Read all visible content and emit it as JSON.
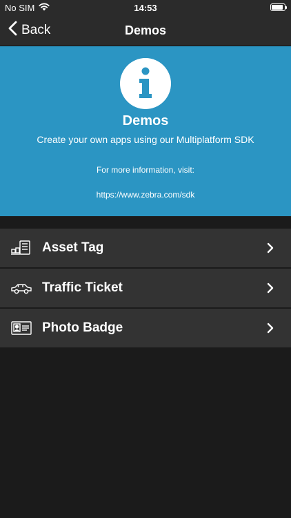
{
  "status_bar": {
    "carrier": "No SIM",
    "time": "14:53",
    "wifi_icon": "wifi-icon",
    "battery_icon": "battery-icon"
  },
  "nav": {
    "back_label": "Back",
    "title": "Demos"
  },
  "info": {
    "icon": "info-icon",
    "title": "Demos",
    "subtitle": "Create your own apps using our Multiplatform SDK",
    "more_info": "For more information, visit:",
    "url": "https://www.zebra.com/sdk"
  },
  "menu": {
    "items": [
      {
        "label": "Asset Tag",
        "icon": "asset-tag-icon"
      },
      {
        "label": "Traffic Ticket",
        "icon": "car-icon"
      },
      {
        "label": "Photo Badge",
        "icon": "badge-icon"
      }
    ]
  },
  "colors": {
    "status_bar": "#2b2b2b",
    "banner": "#2b95c3",
    "list_item": "#333333",
    "background": "#1b1b1b",
    "text": "#ffffff"
  }
}
